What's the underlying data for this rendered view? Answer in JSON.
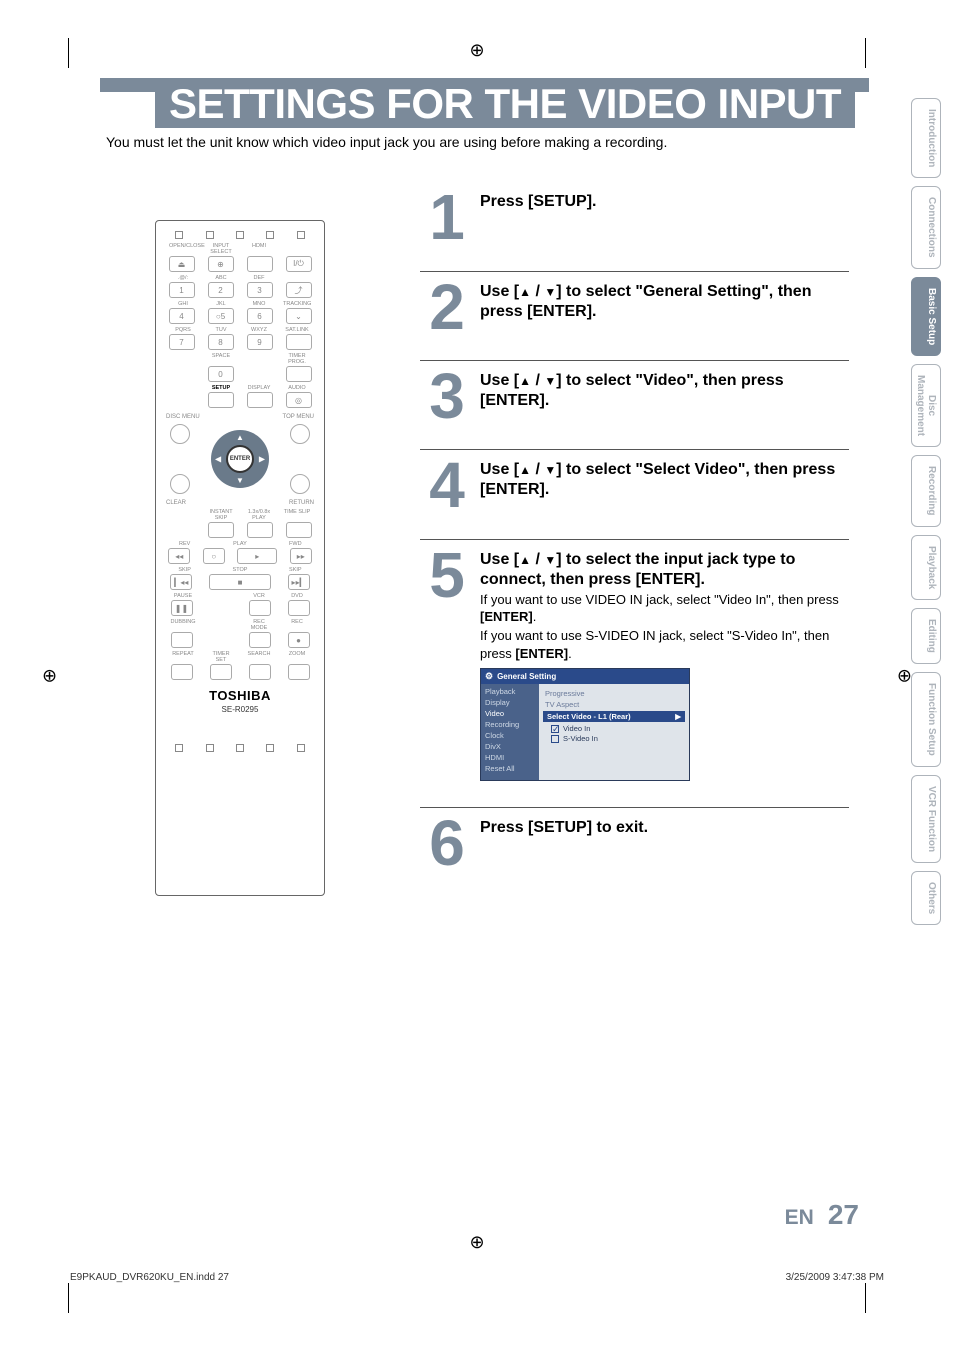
{
  "page": {
    "title": "SETTINGS FOR THE VIDEO INPUT",
    "intro": "You must let the unit know which video input jack you are using before making a recording."
  },
  "tabs": [
    {
      "label": "Introduction",
      "active": false
    },
    {
      "label": "Connections",
      "active": false
    },
    {
      "label": "Basic Setup",
      "active": true
    },
    {
      "label": "Disc\nManagement",
      "active": false
    },
    {
      "label": "Recording",
      "active": false
    },
    {
      "label": "Playback",
      "active": false
    },
    {
      "label": "Editing",
      "active": false
    },
    {
      "label": "Function Setup",
      "active": false
    },
    {
      "label": "VCR Function",
      "active": false
    },
    {
      "label": "Others",
      "active": false
    }
  ],
  "steps": {
    "s1": {
      "num": "1",
      "head": "Press [SETUP]."
    },
    "s2": {
      "num": "2",
      "head_a": "Use [",
      "head_b": "] to select \"General Setting\", then press [ENTER]."
    },
    "s3": {
      "num": "3",
      "head_a": "Use [",
      "head_b": "] to select \"Video\", then press [ENTER]."
    },
    "s4": {
      "num": "4",
      "head_a": "Use [",
      "head_b": "] to select \"Select Video\", then press [ENTER]."
    },
    "s5": {
      "num": "5",
      "head_a": "Use [",
      "head_b": "] to select the input jack type to connect, then press [ENTER].",
      "sub1a": "If you want to use VIDEO IN jack, select \"Video In\", then press ",
      "sub1b": "[ENTER]",
      "sub1c": ".",
      "sub2a": " If you want to use S-VIDEO IN jack, select \"S-Video In\", then press ",
      "sub2b": "[ENTER]",
      "sub2c": "."
    },
    "s6": {
      "num": "6",
      "head": "Press [SETUP] to exit."
    }
  },
  "osd": {
    "title": "General Setting",
    "left": [
      "Playback",
      "Display",
      "Video",
      "Recording",
      "Clock",
      "DivX",
      "HDMI",
      "Reset All"
    ],
    "mid_prog": "Progressive",
    "mid_tv": "TV Aspect",
    "highlight": "Select Video - L1 (Rear)",
    "opt1": "Video In",
    "opt2": "S-Video In"
  },
  "remote": {
    "row1_labels": [
      "OPEN/CLOSE",
      "INPUT SELECT",
      "HDMI",
      ""
    ],
    "row1_glyphs": [
      "⏏",
      "⊕",
      "",
      "I/⏻"
    ],
    "row2_labels": [
      ".@/:",
      "ABC",
      "DEF",
      ""
    ],
    "row2_glyphs": [
      "1",
      "2",
      "3",
      "⤴"
    ],
    "row3_labels": [
      "GHI",
      "JKL",
      "MNO",
      "TRACKING"
    ],
    "row3_glyphs": [
      "4",
      "5",
      "6",
      "⌄"
    ],
    "row3_dot": "○",
    "row4_labels": [
      "PQRS",
      "TUV",
      "WXYZ",
      "SAT.LINK"
    ],
    "row4_glyphs": [
      "7",
      "8",
      "9",
      ""
    ],
    "row5_labels": [
      "",
      "SPACE",
      "",
      "TIMER PROG."
    ],
    "row5_glyphs": [
      "",
      "0",
      "",
      ""
    ],
    "row6_labels": [
      "",
      "SETUP",
      "DISPLAY",
      "AUDIO"
    ],
    "row6_glyphs": [
      "",
      "",
      "",
      "◎"
    ],
    "disc_menu": "DISC MENU",
    "top_menu": "TOP MENU",
    "clear": "CLEAR",
    "return": "RETURN",
    "enter": "ENTER",
    "row_instant_labels": [
      "",
      "INSTANT SKIP",
      "1.3x/0.8x PLAY",
      "TIME SLIP"
    ],
    "transport_lbls": [
      "REV",
      "PLAY",
      "FWD"
    ],
    "transport_glyphs": [
      "◂◂",
      "○",
      "▸",
      "▸▸"
    ],
    "transport2_lbls": [
      "SKIP",
      "STOP",
      "SKIP"
    ],
    "transport2_glyphs": [
      "▎◂◂",
      "■",
      "▸▸▎"
    ],
    "transport3_lbls": [
      "PAUSE",
      "",
      "VCR",
      "DVD"
    ],
    "transport3_glyphs": [
      "❚❚",
      "",
      "",
      ""
    ],
    "transport4_lbls": [
      "DUBBING",
      "",
      "REC MODE",
      "REC"
    ],
    "transport4_glyphs": [
      "",
      "",
      "",
      "●"
    ],
    "transport5_lbls": [
      "REPEAT",
      "TIMER SET",
      "SEARCH",
      "ZOOM"
    ],
    "brand": "TOSHIBA",
    "model": "SE-R0295"
  },
  "footer": {
    "lang": "EN",
    "page_num": "27",
    "file_left": "E9PKAUD_DVR620KU_EN.indd   27",
    "file_right": "3/25/2009   3:47:38 PM"
  }
}
